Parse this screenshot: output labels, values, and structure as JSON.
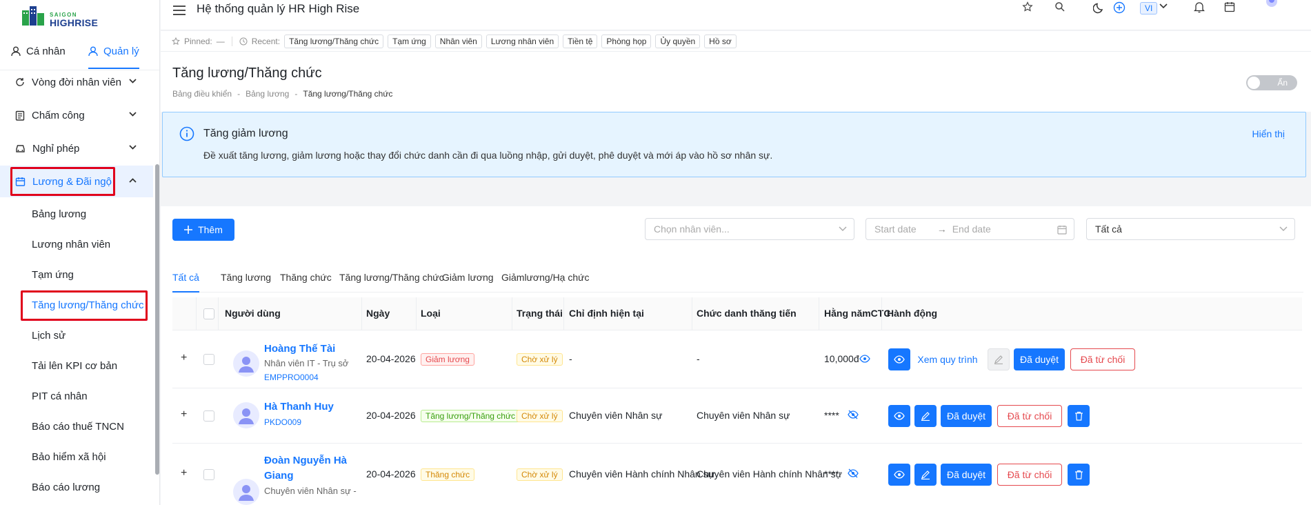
{
  "logo": {
    "line1": "SAIGON",
    "line2": "HIGHRISE"
  },
  "sidebar": {
    "tabs": [
      {
        "label": "Cá nhân"
      },
      {
        "label": "Quản lý"
      }
    ],
    "groups": [
      {
        "label": "Vòng đời nhân viên"
      },
      {
        "label": "Chấm công"
      },
      {
        "label": "Nghỉ phép"
      },
      {
        "label": "Lương & Đãi ngộ"
      }
    ],
    "subitems": [
      {
        "label": "Bảng lương"
      },
      {
        "label": "Lương nhân viên"
      },
      {
        "label": "Tạm ứng"
      },
      {
        "label": "Tăng lương/Thăng chức"
      },
      {
        "label": "Lịch sử"
      },
      {
        "label": "Tải lên KPI cơ bản"
      },
      {
        "label": "PIT cá nhân"
      },
      {
        "label": "Báo cáo thuế TNCN"
      },
      {
        "label": "Bảo hiểm xã hội"
      },
      {
        "label": "Báo cáo lương"
      }
    ]
  },
  "header": {
    "title": "Hệ thống quản lý HR High Rise",
    "lang": "VI"
  },
  "recent": {
    "pinned_label": "Pinned:",
    "pinned_value": "—",
    "recent_label": "Recent:",
    "chips": [
      "Tăng lương/Thăng chức",
      "Tạm ứng",
      "Nhân viên",
      "Lương nhân viên",
      "Tiền tệ",
      "Phòng họp",
      "Ủy quyền",
      "Hồ sơ"
    ]
  },
  "page": {
    "title": "Tăng lương/Thăng chức",
    "breadcrumb": [
      "Bảng điều khiển",
      "-",
      "Bảng lương",
      "-",
      "Tăng lương/Thăng chức"
    ],
    "toggle_label": "Ẩn"
  },
  "alert": {
    "title": "Tăng giảm lương",
    "description": "Đề xuất tăng lương, giảm lương hoặc thay đổi chức danh cần đi qua luồng nhập, gửi duyệt, phê duyệt và mới áp vào hồ sơ nhân sự.",
    "action": "Hiển thị"
  },
  "filters": {
    "add_label": "Thêm",
    "employee_placeholder": "Chọn nhân viên...",
    "start_placeholder": "Start date",
    "arrow": "→",
    "end_placeholder": "End date",
    "status_value": "Tất cả"
  },
  "tabs": [
    {
      "label": "Tất cả"
    },
    {
      "label": "Tăng lương"
    },
    {
      "label": "Thăng chức"
    },
    {
      "label": "Tăng lương/Thăng chức"
    },
    {
      "label": "Giảm lương"
    },
    {
      "label": "Giảmlương/Hạ chức"
    }
  ],
  "table": {
    "columns": [
      "Người dùng",
      "Ngày",
      "Loại",
      "Trạng thái",
      "Chỉ định hiện tại",
      "Chức danh thăng tiến",
      "Hằng nămCTC",
      "Hành động"
    ],
    "rows": [
      {
        "expand": "+",
        "name": "Hoàng Thế Tài",
        "sub": "Nhân viên IT - Trụ sở",
        "code": "EMPPRO0004",
        "date": "20-04-2026",
        "type": "Giảm lương",
        "status": "Chờ xử lý",
        "current": "-",
        "promoted": "-",
        "ctc": "10,000đ",
        "view_process": "Xem quy trình",
        "approve": "Đã duyệt",
        "reject": "Đã từ chối"
      },
      {
        "expand": "+",
        "name": "Hà Thanh Huy",
        "code": "PKDO009",
        "date": "20-04-2026",
        "type": "Tăng lương/Thăng chức",
        "status": "Chờ xử lý",
        "current": "Chuyên viên Nhân sự",
        "promoted": "Chuyên viên Nhân sự",
        "ctc": "****",
        "approve": "Đã duyệt",
        "reject": "Đã từ chối"
      },
      {
        "expand": "+",
        "name_line1": "Đoàn Nguyễn Hà",
        "name_line2": "Giang",
        "sub": "Chuyên viên Nhân sự -",
        "date": "20-04-2026",
        "type": "Thăng chức",
        "status": "Chờ xử lý",
        "current": "Chuyên viên Hành chính Nhân sự",
        "promoted": "Chuyên viên Hành chính Nhân sự",
        "ctc": "****",
        "approve": "Đã duyệt",
        "reject": "Đã từ chối"
      }
    ]
  }
}
